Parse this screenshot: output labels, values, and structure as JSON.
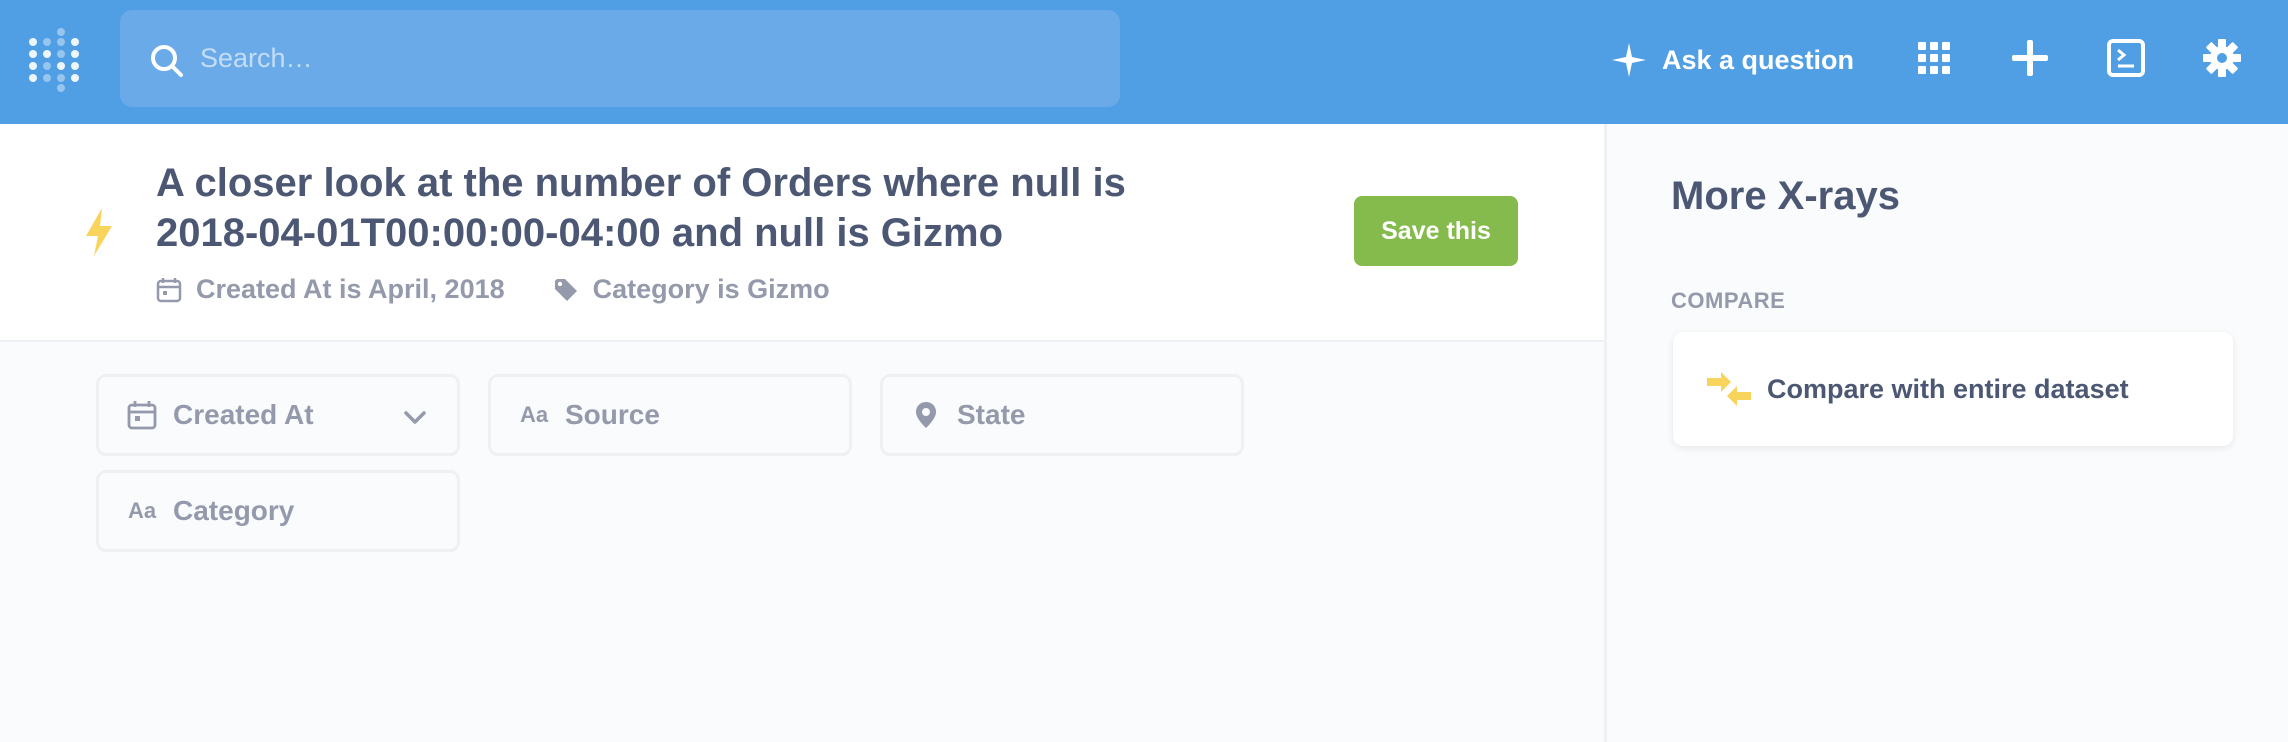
{
  "nav": {
    "search_placeholder": "Search…",
    "ask_label": "Ask a question",
    "icons": [
      "sparkle-icon",
      "grid-icon",
      "plus-icon",
      "sql-editor-icon",
      "gear-icon"
    ]
  },
  "header": {
    "title": "A closer look at the number of Orders where null is 2018-04-01T00:00:00-04:00 and null is Gizmo",
    "chips": [
      {
        "icon": "calendar-icon",
        "label": "Created At is April, 2018"
      },
      {
        "icon": "tag-icon",
        "label": "Category is Gizmo"
      }
    ],
    "save_label": "Save this"
  },
  "filters": [
    {
      "icon": "calendar-icon",
      "label": "Created At",
      "has_dropdown": true
    },
    {
      "icon": "text-icon",
      "icon_text": "Aa",
      "label": "Source"
    },
    {
      "icon": "location-pin-icon",
      "label": "State"
    },
    {
      "icon": "text-icon",
      "icon_text": "Aa",
      "label": "Category"
    }
  ],
  "sidebar": {
    "title": "More X-rays",
    "section_label": "COMPARE",
    "compare_item": {
      "icon": "compare-arrows-icon",
      "label": "Compare with entire dataset"
    }
  },
  "colors": {
    "nav_bg": "#509ee3",
    "save_button": "#84bb4c",
    "bolt": "#f9d45c",
    "text_dark": "#4c5773",
    "text_light": "#949aab"
  }
}
